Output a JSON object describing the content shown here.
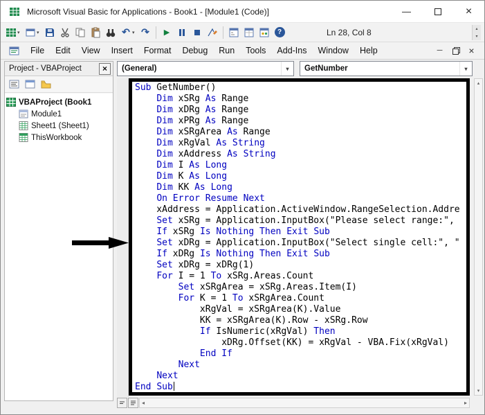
{
  "colors": {
    "keyword_blue": "#0000C0",
    "code_text": "#000000",
    "annotation_black": "#000000",
    "run_green": "#13813f",
    "office_blue": "#2b579a"
  },
  "window": {
    "title": "Microsoft Visual Basic for Applications - Book1 - [Module1 (Code)]",
    "controls": {
      "minimize": "—",
      "close": "×"
    }
  },
  "toolbar": {
    "position_indicator": "Ln 28, Col 8",
    "icons": [
      "view-microsoft-excel",
      "insert-userform",
      "save",
      "cut",
      "copy",
      "paste",
      "find",
      "undo",
      "redo",
      "run",
      "break",
      "reset",
      "design-mode",
      "project-explorer",
      "properties-window",
      "object-browser",
      "help"
    ],
    "undo_glyph": "↶",
    "redo_glyph": "↷",
    "run_glyph": "▶",
    "help_glyph": "?"
  },
  "menubar": {
    "items": [
      "File",
      "Edit",
      "View",
      "Insert",
      "Format",
      "Debug",
      "Run",
      "Tools",
      "Add-Ins",
      "Window",
      "Help"
    ]
  },
  "project_panel": {
    "title": "Project - VBAProject",
    "close_glyph": "×",
    "tree": [
      {
        "label": "VBAProject (Book1",
        "icon": "vba-project"
      },
      {
        "label": "Module1",
        "icon": "module"
      },
      {
        "label": "Sheet1 (Sheet1)",
        "icon": "worksheet"
      },
      {
        "label": "ThisWorkbook",
        "icon": "workbook"
      }
    ]
  },
  "code_panel": {
    "object_box": "(General)",
    "procedure_box": "GetNumber",
    "lines": [
      [
        [
          "k",
          "Sub"
        ],
        [
          "t",
          " GetNumber()"
        ]
      ],
      [
        [
          "t",
          "    "
        ],
        [
          "k",
          "Dim"
        ],
        [
          "t",
          " xSRg "
        ],
        [
          "k",
          "As"
        ],
        [
          "t",
          " Range"
        ]
      ],
      [
        [
          "t",
          "    "
        ],
        [
          "k",
          "Dim"
        ],
        [
          "t",
          " xDRg "
        ],
        [
          "k",
          "As"
        ],
        [
          "t",
          " Range"
        ]
      ],
      [
        [
          "t",
          "    "
        ],
        [
          "k",
          "Dim"
        ],
        [
          "t",
          " xPRg "
        ],
        [
          "k",
          "As"
        ],
        [
          "t",
          " Range"
        ]
      ],
      [
        [
          "t",
          "    "
        ],
        [
          "k",
          "Dim"
        ],
        [
          "t",
          " xSRgArea "
        ],
        [
          "k",
          "As"
        ],
        [
          "t",
          " Range"
        ]
      ],
      [
        [
          "t",
          "    "
        ],
        [
          "k",
          "Dim"
        ],
        [
          "t",
          " xRgVal "
        ],
        [
          "k",
          "As"
        ],
        [
          "t",
          " "
        ],
        [
          "k",
          "String"
        ]
      ],
      [
        [
          "t",
          "    "
        ],
        [
          "k",
          "Dim"
        ],
        [
          "t",
          " xAddress "
        ],
        [
          "k",
          "As"
        ],
        [
          "t",
          " "
        ],
        [
          "k",
          "String"
        ]
      ],
      [
        [
          "t",
          "    "
        ],
        [
          "k",
          "Dim"
        ],
        [
          "t",
          " I "
        ],
        [
          "k",
          "As"
        ],
        [
          "t",
          " "
        ],
        [
          "k",
          "Long"
        ]
      ],
      [
        [
          "t",
          "    "
        ],
        [
          "k",
          "Dim"
        ],
        [
          "t",
          " K "
        ],
        [
          "k",
          "As"
        ],
        [
          "t",
          " "
        ],
        [
          "k",
          "Long"
        ]
      ],
      [
        [
          "t",
          "    "
        ],
        [
          "k",
          "Dim"
        ],
        [
          "t",
          " KK "
        ],
        [
          "k",
          "As"
        ],
        [
          "t",
          " "
        ],
        [
          "k",
          "Long"
        ]
      ],
      [
        [
          "t",
          "    "
        ],
        [
          "k",
          "On"
        ],
        [
          "t",
          " "
        ],
        [
          "k",
          "Error"
        ],
        [
          "t",
          " "
        ],
        [
          "k",
          "Resume"
        ],
        [
          "t",
          " "
        ],
        [
          "k",
          "Next"
        ]
      ],
      [
        [
          "t",
          "    xAddress = Application.ActiveWindow.RangeSelection.Addre"
        ]
      ],
      [
        [
          "t",
          "    "
        ],
        [
          "k",
          "Set"
        ],
        [
          "t",
          " xSRg = Application.InputBox(\"Please select range:\","
        ]
      ],
      [
        [
          "t",
          "    "
        ],
        [
          "k",
          "If"
        ],
        [
          "t",
          " xSRg "
        ],
        [
          "k",
          "Is"
        ],
        [
          "t",
          " "
        ],
        [
          "k",
          "Nothing"
        ],
        [
          "t",
          " "
        ],
        [
          "k",
          "Then"
        ],
        [
          "t",
          " "
        ],
        [
          "k",
          "Exit"
        ],
        [
          "t",
          " "
        ],
        [
          "k",
          "Sub"
        ]
      ],
      [
        [
          "t",
          "    "
        ],
        [
          "k",
          "Set"
        ],
        [
          "t",
          " xDRg = Application.InputBox(\"Select single cell:\", \""
        ]
      ],
      [
        [
          "t",
          "    "
        ],
        [
          "k",
          "If"
        ],
        [
          "t",
          " xDRg "
        ],
        [
          "k",
          "Is"
        ],
        [
          "t",
          " "
        ],
        [
          "k",
          "Nothing"
        ],
        [
          "t",
          " "
        ],
        [
          "k",
          "Then"
        ],
        [
          "t",
          " "
        ],
        [
          "k",
          "Exit"
        ],
        [
          "t",
          " "
        ],
        [
          "k",
          "Sub"
        ]
      ],
      [
        [
          "t",
          "    "
        ],
        [
          "k",
          "Set"
        ],
        [
          "t",
          " xDRg = xDRg(1)"
        ]
      ],
      [
        [
          "t",
          "    "
        ],
        [
          "k",
          "For"
        ],
        [
          "t",
          " I = 1 "
        ],
        [
          "k",
          "To"
        ],
        [
          "t",
          " xSRg.Areas.Count"
        ]
      ],
      [
        [
          "t",
          "        "
        ],
        [
          "k",
          "Set"
        ],
        [
          "t",
          " xSRgArea = xSRg.Areas.Item(I)"
        ]
      ],
      [
        [
          "t",
          "        "
        ],
        [
          "k",
          "For"
        ],
        [
          "t",
          " K = 1 "
        ],
        [
          "k",
          "To"
        ],
        [
          "t",
          " xSRgArea.Count"
        ]
      ],
      [
        [
          "t",
          "            xRgVal = xSRgArea(K).Value"
        ]
      ],
      [
        [
          "t",
          "            KK = xSRgArea(K).Row - xSRg.Row"
        ]
      ],
      [
        [
          "t",
          "            "
        ],
        [
          "k",
          "If"
        ],
        [
          "t",
          " IsNumeric(xRgVal) "
        ],
        [
          "k",
          "Then"
        ]
      ],
      [
        [
          "t",
          "                xDRg.Offset(KK) = xRgVal - VBA.Fix(xRgVal)"
        ]
      ],
      [
        [
          "t",
          "            "
        ],
        [
          "k",
          "End"
        ],
        [
          "t",
          " "
        ],
        [
          "k",
          "If"
        ]
      ],
      [
        [
          "t",
          "        "
        ],
        [
          "k",
          "Next"
        ]
      ],
      [
        [
          "t",
          "    "
        ],
        [
          "k",
          "Next"
        ]
      ],
      [
        [
          "k",
          "End"
        ],
        [
          "t",
          " "
        ],
        [
          "k",
          "Sub"
        ]
      ]
    ]
  }
}
